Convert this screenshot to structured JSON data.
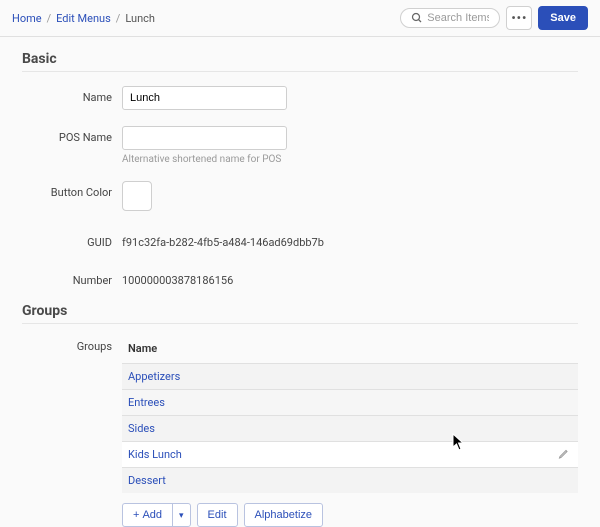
{
  "breadcrumb": {
    "home": "Home",
    "edit_menus": "Edit Menus",
    "current": "Lunch"
  },
  "topbar": {
    "search_placeholder": "Search Items",
    "more_label": "•••",
    "save_label": "Save"
  },
  "sections": {
    "basic_title": "Basic",
    "groups_title": "Groups"
  },
  "fields": {
    "name_label": "Name",
    "name_value": "Lunch",
    "pos_name_label": "POS Name",
    "pos_name_value": "",
    "pos_name_help": "Alternative shortened name for POS",
    "button_color_label": "Button Color",
    "guid_label": "GUID",
    "guid_value": "f91c32fa-b282-4fb5-a484-146ad69dbb7b",
    "number_label": "Number",
    "number_value": "100000003878186156"
  },
  "groups": {
    "side_label": "Groups",
    "column_header": "Name",
    "items": [
      "Appetizers",
      "Entrees",
      "Sides",
      "Kids Lunch",
      "Dessert"
    ],
    "actions": {
      "add": "Add",
      "edit": "Edit",
      "alphabetize": "Alphabetize"
    }
  }
}
